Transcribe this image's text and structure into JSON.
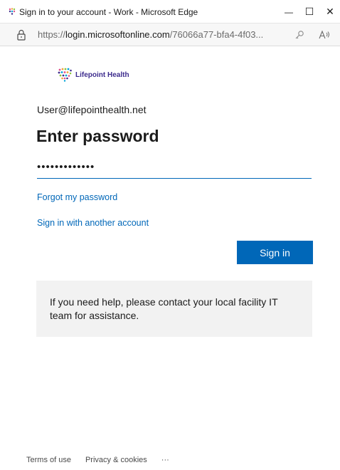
{
  "window": {
    "title": "Sign in to your account - Work - Microsoft Edge",
    "minimize_label": "—",
    "maximize_label": "☐",
    "close_label": "✕"
  },
  "address": {
    "prefix": "https://",
    "host": "login.microsoftonline.com",
    "rest": "/76066a77-bfa4-4f03..."
  },
  "logo": {
    "text": "Lifepoint Health"
  },
  "signin": {
    "identity": "User@lifepointhealth.net",
    "heading": "Enter password",
    "password_masked": "•••••••••••••",
    "forgot_link": "Forgot my password",
    "other_account_link": "Sign in with another account",
    "button_label": "Sign in"
  },
  "help": {
    "text": "If you need help, please contact your local facility IT team for assistance."
  },
  "footer": {
    "terms": "Terms of use",
    "privacy": "Privacy & cookies",
    "more": "···"
  },
  "colors": {
    "accent": "#0067b8",
    "help_bg": "#f2f2f2",
    "logo_purple": "#3d2c8d"
  }
}
